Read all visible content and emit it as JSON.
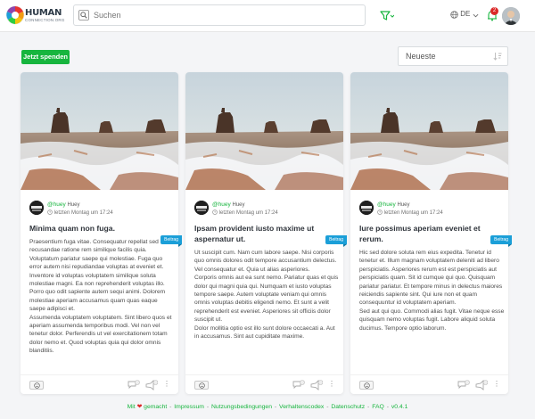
{
  "header": {
    "logo": {
      "name": "HUMAN",
      "sub": "CONNECTION.ORG"
    },
    "search_placeholder": "Suchen",
    "language": "DE",
    "notification_count": "2"
  },
  "toolbar": {
    "donate_label": "Jetzt spenden",
    "sort_label": "Neueste"
  },
  "posts": [
    {
      "author_handle": "@huey",
      "author_name": "Huey",
      "date": "letzten Montag um 17:24",
      "title": "Minima quam non fuga.",
      "body": "Praesentium fuga vitae. Consequatur repellat sed recusandae ratione rem similique facilis quia. Voluptatum pariatur saepe qui molestiae. Fuga quo error autem nisi repudiandae voluptas at eveniet et. Inventore id voluptas voluptatem similique soluta molestiae magni. Ea non reprehenderit voluptas illo. Porro quo odit sapiente autem sequi animi. Dolorem molestiae aperiam accusamus quam quas eaque saepe adipisci et.\nAssumenda voluptatem voluptatem. Sint libero quos et aperiam assumenda temporibus modi. Vel non vel tenetur dolor. Perferendis ut vel exercitationem totam dolor nemo et. Quod voluptas quia qui dolor omnis blanditiis.",
      "badge": "Beitrag"
    },
    {
      "author_handle": "@huey",
      "author_name": "Huey",
      "date": "letzten Montag um 17:24",
      "title": "Ipsam provident iusto maxime ut aspernatur ut.",
      "body": "Ut suscipit cum. Nam cum labore saepe. Nisi corporis quo omnis dolores odit tempore accusantium delectus. Vel consequatur et. Quia ut alias asperiores.\nCorporis omnis aut ea sunt nemo. Pariatur quas et quis dolor qui magni quia qui. Numquam et iusto voluptas tempore saepe. Autem voluptate veniam qui omnis omnis voluptas debitis eligendi nemo. Et sunt a velit reprehenderit est eveniet. Asperiores sit officiis dolor suscipit ut.\nDolor mollitia optio est illo sunt dolore occaecati a. Aut in accusamus. Sint aut cupiditate maxime.",
      "badge": "Beitrag"
    },
    {
      "author_handle": "@huey",
      "author_name": "Huey",
      "date": "letzten Montag um 17:24",
      "title": "Iure possimus aperiam eveniet et rerum.",
      "body": "Hic sed dolore soluta rem eius expedita. Tenetur id tenetur et. Illum magnam voluptatem deleniti ad libero perspiciatis. Asperiores rerum est est perspiciatis aut perspiciatis quam. Sit id cumque qui quo. Quisquam pariatur pariatur. Et tempore minus in delectus maiores reiciendis sapiente sint. Qui iure non et quam consequuntur id voluptatem aperiam.\nSed aut qui quo. Commodi alias fugit. Vitae neque esse quisquam nemo voluptas fugit. Labore aliquid soluta ducimus. Tempore optio laborum.",
      "badge": "Beitrag"
    }
  ],
  "footer": {
    "made_prefix": "Mit",
    "made_suffix": "gemacht",
    "links": [
      "Impressum",
      "Nutzungsbedingungen",
      "Verhaltenscodex",
      "Datenschutz",
      "FAQ",
      "v0.4.1"
    ]
  },
  "colors": {
    "accent": "#17b53e",
    "ribbon": "#1b9fd8",
    "badge": "#db2828"
  }
}
